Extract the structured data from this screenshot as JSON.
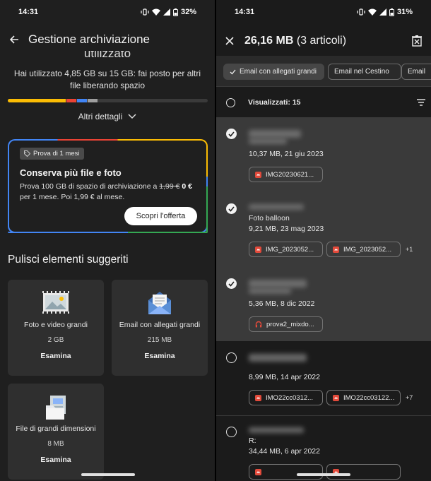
{
  "left": {
    "status": {
      "time": "14:31",
      "battery": "32%"
    },
    "appbar": {
      "title": "Gestione archiviazione"
    },
    "cut_heading": "utilizzato",
    "usage": {
      "text": "Hai utilizzato 4,85 GB su 15 GB: fai posto per altri file liberando spazio",
      "segments": [
        {
          "color": "#fbbc04",
          "fraction": 0.29
        },
        {
          "color": "#ea4335",
          "fraction": 0.05
        },
        {
          "color": "#4285f4",
          "fraction": 0.05
        },
        {
          "color": "#9e9e9e",
          "fraction": 0.05
        }
      ]
    },
    "more_details": "Altri dettagli",
    "offer": {
      "chip": "Prova di 1 mesi",
      "title": "Conserva più file e foto",
      "desc_a": "Prova 100 GB di spazio di archiviazione a ",
      "old_price": "1,99 €",
      "new_price": "0 €",
      "desc_b": " per 1 mese. Poi 1,99 € al mese.",
      "button": "Scopri l'offerta"
    },
    "section_title": "Pulisci elementi suggeriti",
    "categories": [
      {
        "title": "Foto e video grandi",
        "size": "2 GB",
        "button": "Esamina",
        "icon": "photo-icon"
      },
      {
        "title": "Email con allegati grandi",
        "size": "215 MB",
        "button": "Esamina",
        "icon": "mail-icon"
      },
      {
        "title": "File di grandi dimensioni",
        "size": "8 MB",
        "button": "Esamina",
        "icon": "file-icon"
      }
    ]
  },
  "right": {
    "status": {
      "time": "14:31",
      "battery": "31%"
    },
    "selection": {
      "size": "26,16 MB",
      "count": "(3 articoli)"
    },
    "filters": [
      "Email con allegati grandi",
      "Email nel Cestino",
      "Email"
    ],
    "shown": "Visualizzati: 15",
    "emails": [
      {
        "selected": true,
        "subject": "",
        "meta": "10,37 MB, 21 giu 2023",
        "attachments": [
          "IMG20230621..."
        ],
        "more": ""
      },
      {
        "selected": true,
        "subject": "Foto balloon",
        "meta": "9,21 MB, 23 mag 2023",
        "attachments": [
          "IMG_2023052...",
          "IMG_2023052..."
        ],
        "more": "+1"
      },
      {
        "selected": true,
        "subject": "",
        "meta": "5,36 MB, 8 dic 2022",
        "attachments": [
          "prova2_mixdo..."
        ],
        "more": ""
      },
      {
        "selected": false,
        "subject": "",
        "meta": "8,99 MB, 14 apr 2022",
        "attachments": [
          "IMO22cc0312...",
          "IMO22cc03122..."
        ],
        "more": "+7"
      },
      {
        "selected": false,
        "subject": "R:",
        "meta": "34,44 MB, 6 apr 2022",
        "attachments": [],
        "more": ""
      }
    ]
  }
}
